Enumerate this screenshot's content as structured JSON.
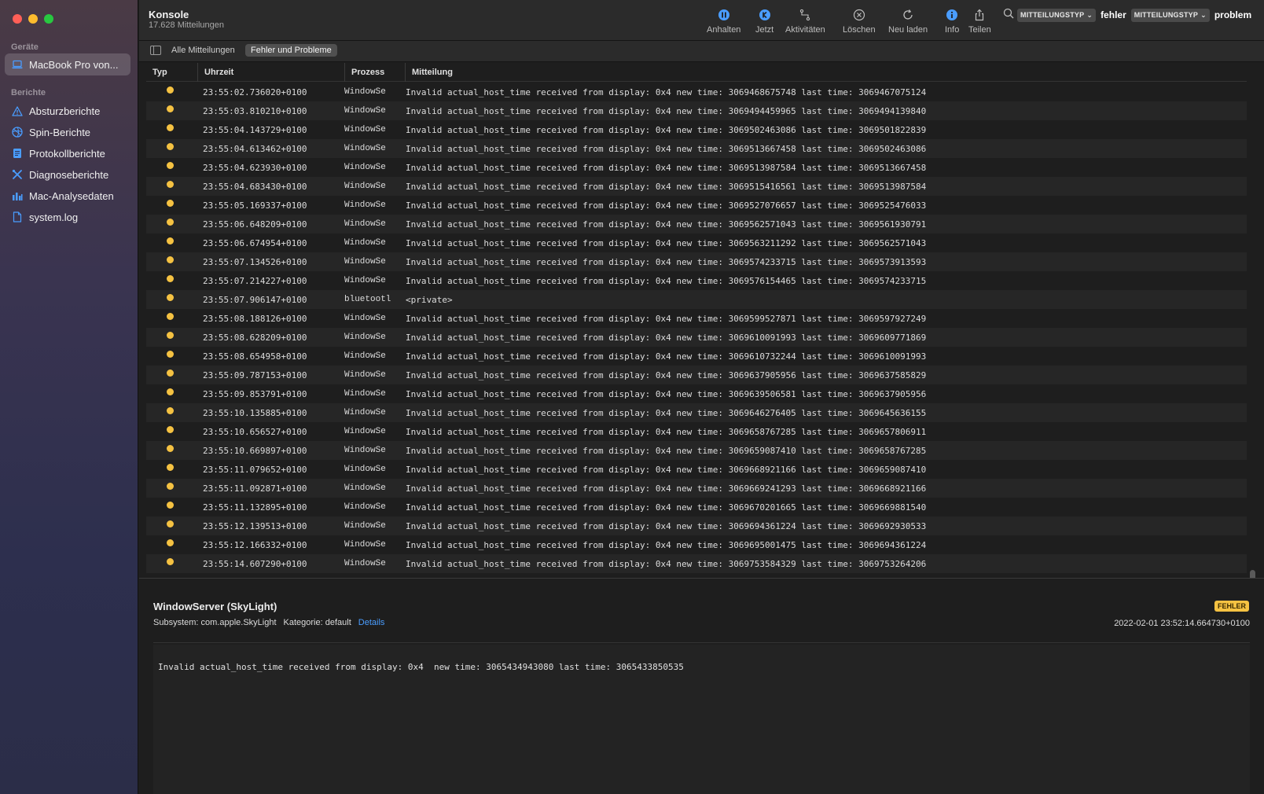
{
  "window": {
    "title": "Konsole",
    "subtitle": "17.628 Mitteilungen"
  },
  "sidebar": {
    "devices_heading": "Geräte",
    "device": {
      "label": "MacBook Pro von...",
      "icon": "laptop-icon"
    },
    "reports_heading": "Berichte",
    "items": [
      {
        "label": "Absturzberichte",
        "icon": "warning-triangle-icon"
      },
      {
        "label": "Spin-Berichte",
        "icon": "spinner-icon"
      },
      {
        "label": "Protokollberichte",
        "icon": "document-icon"
      },
      {
        "label": "Diagnoseberichte",
        "icon": "tools-icon"
      },
      {
        "label": "Mac-Analysedaten",
        "icon": "bar-chart-icon"
      },
      {
        "label": "system.log",
        "icon": "file-icon"
      }
    ]
  },
  "toolbar": {
    "buttons": [
      {
        "label": "Anhalten",
        "icon": "pause-circle-icon"
      },
      {
        "label": "Jetzt",
        "icon": "jump-now-icon"
      },
      {
        "label": "Aktivitäten",
        "icon": "activities-icon"
      },
      {
        "label": "Löschen",
        "icon": "clear-icon"
      },
      {
        "label": "Neu laden",
        "icon": "reload-icon"
      },
      {
        "label": "Info",
        "icon": "info-icon"
      },
      {
        "label": "Teilen",
        "icon": "share-icon"
      }
    ],
    "search": {
      "token1_type": "MITTEILUNGSTYP",
      "token1_value": "fehler",
      "token2_type": "MITTEILUNGSTYP",
      "token2_value": "problem"
    }
  },
  "filterbar": {
    "tab_all": "Alle Mitteilungen",
    "tab_errors": "Fehler und Probleme"
  },
  "table": {
    "columns": {
      "typ": "Typ",
      "uhrzeit": "Uhrzeit",
      "prozess": "Prozess",
      "mitteilung": "Mitteilung"
    },
    "rows": [
      {
        "time": "23:55:02.736020+0100",
        "process": "WindowSe",
        "message": "Invalid actual_host_time received from display: 0x4  new time: 3069468675748 last time: 3069467075124"
      },
      {
        "time": "23:55:03.810210+0100",
        "process": "WindowSe",
        "message": "Invalid actual_host_time received from display: 0x4  new time: 3069494459965 last time: 3069494139840"
      },
      {
        "time": "23:55:04.143729+0100",
        "process": "WindowSe",
        "message": "Invalid actual_host_time received from display: 0x4  new time: 3069502463086 last time: 3069501822839"
      },
      {
        "time": "23:55:04.613462+0100",
        "process": "WindowSe",
        "message": "Invalid actual_host_time received from display: 0x4  new time: 3069513667458 last time: 3069502463086"
      },
      {
        "time": "23:55:04.623930+0100",
        "process": "WindowSe",
        "message": "Invalid actual_host_time received from display: 0x4  new time: 3069513987584 last time: 3069513667458"
      },
      {
        "time": "23:55:04.683430+0100",
        "process": "WindowSe",
        "message": "Invalid actual_host_time received from display: 0x4  new time: 3069515416561 last time: 3069513987584"
      },
      {
        "time": "23:55:05.169337+0100",
        "process": "WindowSe",
        "message": "Invalid actual_host_time received from display: 0x4  new time: 3069527076657 last time: 3069525476033"
      },
      {
        "time": "23:55:06.648209+0100",
        "process": "WindowSe",
        "message": "Invalid actual_host_time received from display: 0x4  new time: 3069562571043 last time: 3069561930791"
      },
      {
        "time": "23:55:06.674954+0100",
        "process": "WindowSe",
        "message": "Invalid actual_host_time received from display: 0x4  new time: 3069563211292 last time: 3069562571043"
      },
      {
        "time": "23:55:07.134526+0100",
        "process": "WindowSe",
        "message": "Invalid actual_host_time received from display: 0x4  new time: 3069574233715 last time: 3069573913593"
      },
      {
        "time": "23:55:07.214227+0100",
        "process": "WindowSe",
        "message": "Invalid actual_host_time received from display: 0x4  new time: 3069576154465 last time: 3069574233715"
      },
      {
        "time": "23:55:07.906147+0100",
        "process": "bluetootl",
        "message": "<private>"
      },
      {
        "time": "23:55:08.188126+0100",
        "process": "WindowSe",
        "message": "Invalid actual_host_time received from display: 0x4  new time: 3069599527871 last time: 3069597927249"
      },
      {
        "time": "23:55:08.628209+0100",
        "process": "WindowSe",
        "message": "Invalid actual_host_time received from display: 0x4  new time: 3069610091993 last time: 3069609771869"
      },
      {
        "time": "23:55:08.654958+0100",
        "process": "WindowSe",
        "message": "Invalid actual_host_time received from display: 0x4  new time: 3069610732244 last time: 3069610091993"
      },
      {
        "time": "23:55:09.787153+0100",
        "process": "WindowSe",
        "message": "Invalid actual_host_time received from display: 0x4  new time: 3069637905956 last time: 3069637585829"
      },
      {
        "time": "23:55:09.853791+0100",
        "process": "WindowSe",
        "message": "Invalid actual_host_time received from display: 0x4  new time: 3069639506581 last time: 3069637905956"
      },
      {
        "time": "23:55:10.135885+0100",
        "process": "WindowSe",
        "message": "Invalid actual_host_time received from display: 0x4  new time: 3069646276405 last time: 3069645636155"
      },
      {
        "time": "23:55:10.656527+0100",
        "process": "WindowSe",
        "message": "Invalid actual_host_time received from display: 0x4  new time: 3069658767285 last time: 3069657806911"
      },
      {
        "time": "23:55:10.669897+0100",
        "process": "WindowSe",
        "message": "Invalid actual_host_time received from display: 0x4  new time: 3069659087410 last time: 3069658767285"
      },
      {
        "time": "23:55:11.079652+0100",
        "process": "WindowSe",
        "message": "Invalid actual_host_time received from display: 0x4  new time: 3069668921166 last time: 3069659087410"
      },
      {
        "time": "23:55:11.092871+0100",
        "process": "WindowSe",
        "message": "Invalid actual_host_time received from display: 0x4  new time: 3069669241293 last time: 3069668921166"
      },
      {
        "time": "23:55:11.132895+0100",
        "process": "WindowSe",
        "message": "Invalid actual_host_time received from display: 0x4  new time: 3069670201665 last time: 3069669881540"
      },
      {
        "time": "23:55:12.139513+0100",
        "process": "WindowSe",
        "message": "Invalid actual_host_time received from display: 0x4  new time: 3069694361224 last time: 3069692930533"
      },
      {
        "time": "23:55:12.166332+0100",
        "process": "WindowSe",
        "message": "Invalid actual_host_time received from display: 0x4  new time: 3069695001475 last time: 3069694361224"
      },
      {
        "time": "23:55:14.607290+0100",
        "process": "WindowSe",
        "message": "Invalid actual_host_time received from display: 0x4  new time: 3069753584329 last time: 3069753264206"
      }
    ]
  },
  "details": {
    "title": "WindowServer (SkyLight)",
    "subsystem": "Subsystem: com.apple.SkyLight",
    "category": "Kategorie: default",
    "details_link": "Details",
    "badge": "FEHLER",
    "date": "2022-02-01 23:52:14.664730+0100",
    "message": "Invalid actual_host_time received from display: 0x4  new time: 3065434943080 last time: 3065433850535"
  },
  "colors": {
    "accent": "#4a9dff",
    "error_dot": "#f5c242",
    "badge_bg": "#f5c242"
  }
}
